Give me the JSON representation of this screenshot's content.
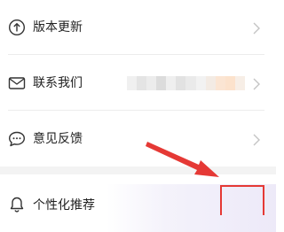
{
  "settings": {
    "items": [
      {
        "label": "版本更新",
        "icon": "arrow-up-circle-icon"
      },
      {
        "label": "联系我们",
        "icon": "mail-icon"
      },
      {
        "label": "意见反馈",
        "icon": "chat-bubble-icon"
      },
      {
        "label": "个性化推荐",
        "icon": "bell-icon"
      }
    ]
  },
  "annotation": {
    "color": "#e53935"
  }
}
